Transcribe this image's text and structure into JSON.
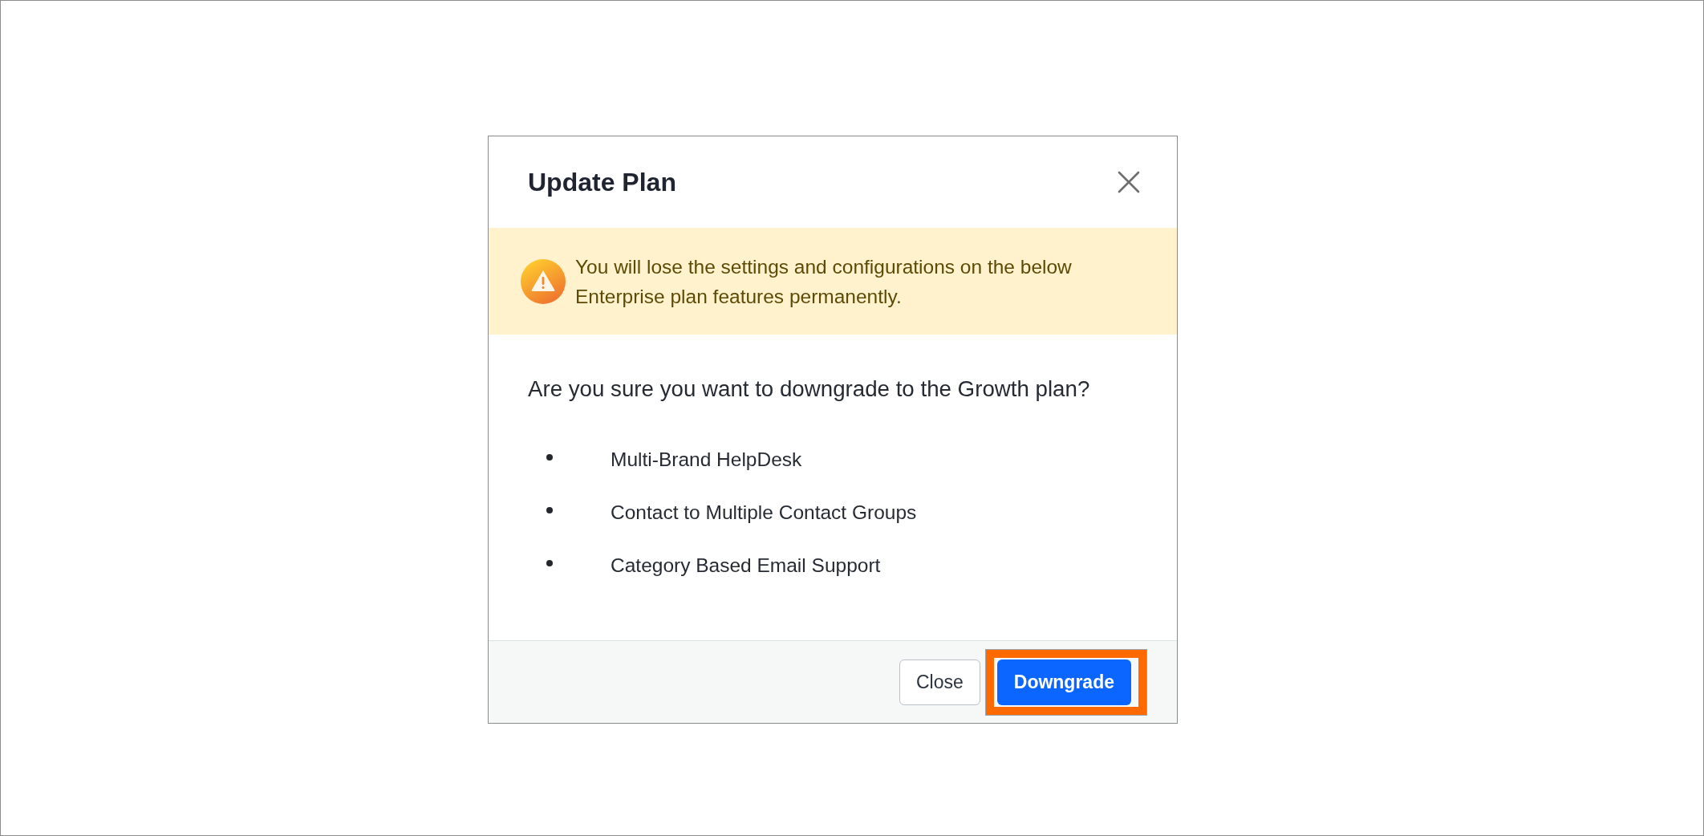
{
  "dialog": {
    "title": "Update Plan"
  },
  "warning": {
    "text": "You will lose the settings and configurations on the below Enterprise plan features permanently."
  },
  "question": "Are you sure you want to downgrade to the Growth plan?",
  "features": [
    "Multi-Brand HelpDesk",
    "Contact to Multiple Contact Groups",
    "Category Based Email Support"
  ],
  "buttons": [
    {
      "label": "Close",
      "kind": "secondary",
      "highlighted": false
    },
    {
      "label": "Downgrade",
      "kind": "primary",
      "highlighted": true
    }
  ]
}
